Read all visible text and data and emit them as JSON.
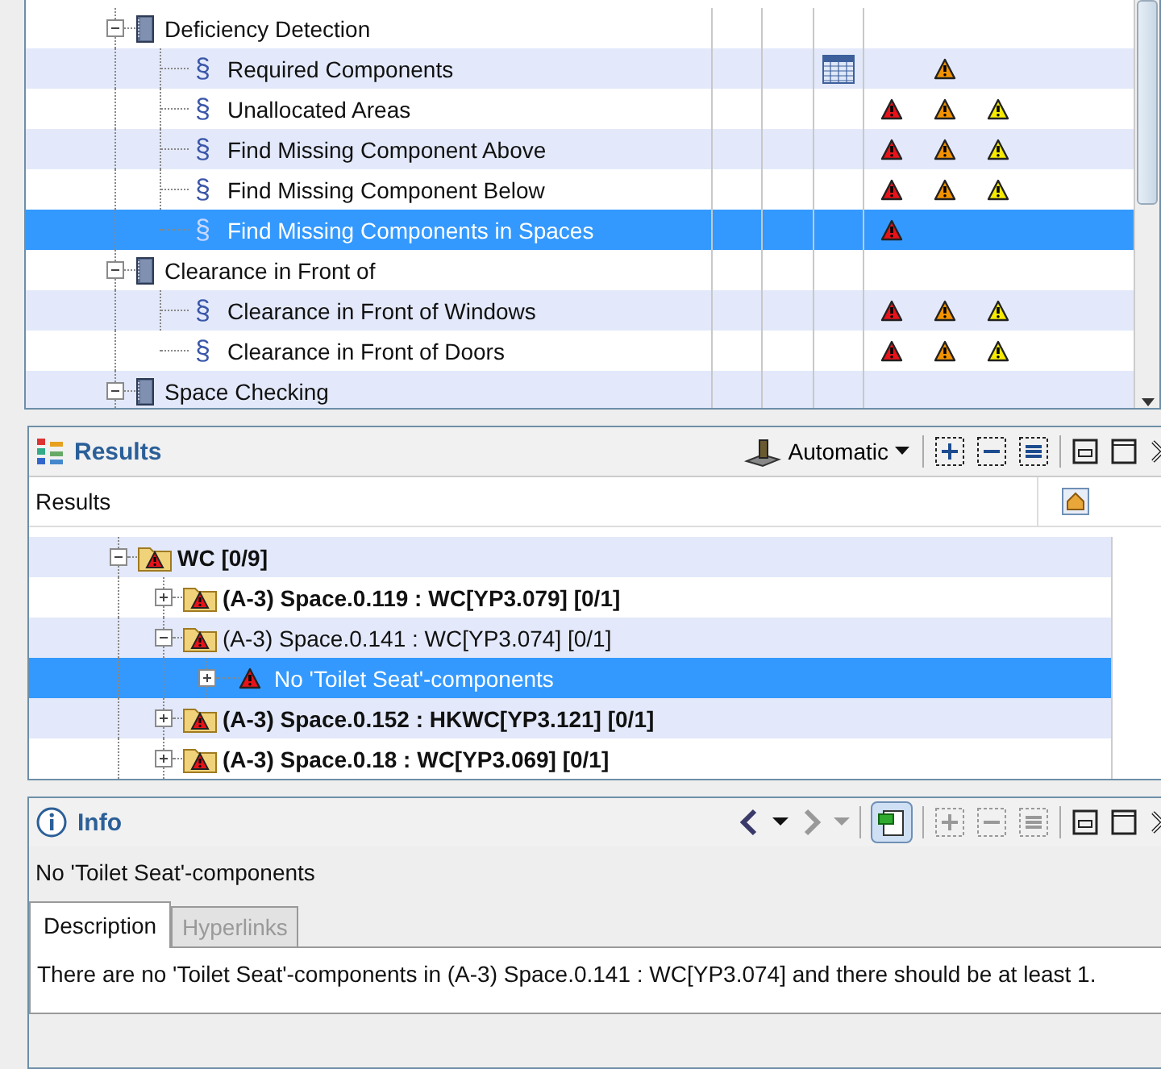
{
  "checks_tree": {
    "rows": [
      {
        "label": "Deficiency Detection",
        "expanded": true,
        "selected": false,
        "children": [
          {
            "symbol": "§",
            "label": "Required Components",
            "table": true,
            "critical": false,
            "moderate": true,
            "low": false,
            "selected": false
          },
          {
            "symbol": "§",
            "label": "Unallocated Areas",
            "table": false,
            "critical": true,
            "moderate": true,
            "low": true,
            "selected": false
          },
          {
            "symbol": "§",
            "label": "Find Missing Component Above",
            "table": false,
            "critical": true,
            "moderate": true,
            "low": true,
            "selected": false
          },
          {
            "symbol": "§",
            "label": "Find Missing Component Below",
            "table": false,
            "critical": true,
            "moderate": true,
            "low": true,
            "selected": false
          },
          {
            "symbol": "§",
            "label": "Find Missing Components in Spaces",
            "table": false,
            "critical": true,
            "moderate": false,
            "low": false,
            "selected": true
          }
        ]
      },
      {
        "label": "Clearance  in Front of",
        "expanded": true,
        "selected": false,
        "children": [
          {
            "symbol": "§",
            "label": "Clearance in Front of Windows",
            "table": false,
            "critical": true,
            "moderate": true,
            "low": true,
            "selected": false
          },
          {
            "symbol": "§",
            "label": "Clearance in Front of Doors",
            "table": false,
            "critical": true,
            "moderate": true,
            "low": true,
            "selected": false
          }
        ]
      },
      {
        "label": "Space Checking",
        "expanded": true,
        "selected": false,
        "children": []
      }
    ]
  },
  "results": {
    "title": "Results",
    "mode": "Automatic",
    "column": "Results",
    "rows": [
      {
        "kind": "group",
        "label": "WC [0/9]",
        "unread": true,
        "expanded": true,
        "selected": false,
        "children": [
          {
            "kind": "group",
            "label": "(A-3) Space.0.119 : WC[YP3.079] [0/1]",
            "unread": true,
            "expanded": false,
            "selected": false
          },
          {
            "kind": "group",
            "label": "(A-3) Space.0.141 : WC[YP3.074] [0/1]",
            "unread": false,
            "expanded": true,
            "selected": false,
            "children": [
              {
                "kind": "issue",
                "label": "No 'Toilet Seat'-components",
                "unread": false,
                "expanded": false,
                "selected": true
              }
            ]
          },
          {
            "kind": "group",
            "label": "(A-3) Space.0.152 : HKWC[YP3.121] [0/1]",
            "unread": true,
            "expanded": false,
            "selected": false
          },
          {
            "kind": "group",
            "label": "(A-3) Space.0.18 : WC[YP3.069] [0/1]",
            "unread": true,
            "expanded": false,
            "selected": false
          }
        ]
      }
    ]
  },
  "info": {
    "title": "Info",
    "heading": "No 'Toilet Seat'-components",
    "tabs": [
      {
        "label": "Description",
        "selected": true,
        "disabled": false
      },
      {
        "label": "Hyperlinks",
        "selected": false,
        "disabled": true
      }
    ],
    "description": "There are no 'Toilet Seat'-components in (A-3) Space.0.141 : WC[YP3.074] and there should be at least 1."
  }
}
